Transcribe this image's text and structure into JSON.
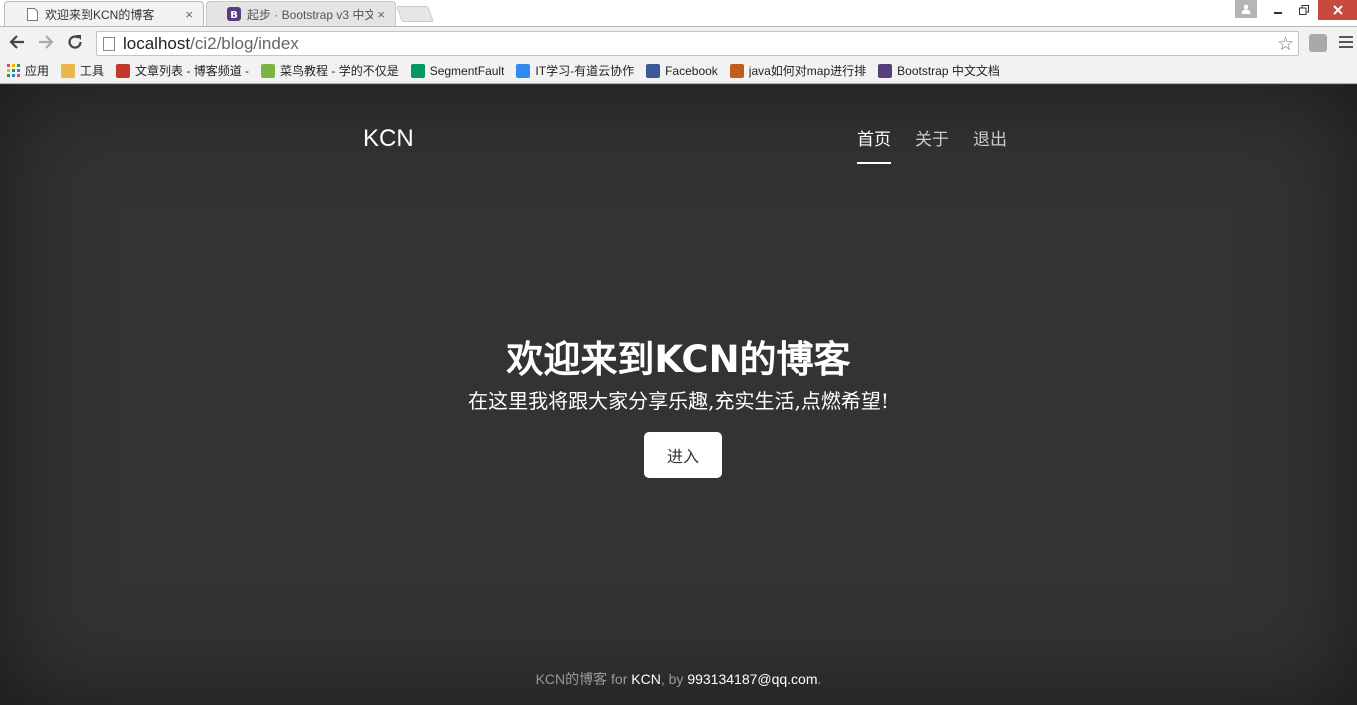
{
  "browser": {
    "tabs": [
      {
        "title": "欢迎来到KCN的博客",
        "active": true
      },
      {
        "title": "起步 · Bootstrap v3 中文",
        "active": false
      }
    ],
    "tab_close_glyph": "×",
    "url_host": "localhost",
    "url_path": "/ci2/blog/index",
    "bookmarks": [
      {
        "label": "应用",
        "icon": "apps-grid-icon",
        "color": "#e04b3a"
      },
      {
        "label": "工具",
        "icon": "folder-icon",
        "color": "#e8b84a"
      },
      {
        "label": "文章列表 - 博客频道 -",
        "icon": "csdn-icon",
        "color": "#c0392b"
      },
      {
        "label": "菜鸟教程 - 学的不仅是",
        "icon": "runoob-icon",
        "color": "#7cb342"
      },
      {
        "label": "SegmentFault",
        "icon": "segmentfault-icon",
        "color": "#009a61"
      },
      {
        "label": "IT学习-有道云协作",
        "icon": "youdao-icon",
        "color": "#2f8bf0"
      },
      {
        "label": "Facebook",
        "icon": "facebook-icon",
        "color": "#3b5998"
      },
      {
        "label": "java如何对map进行排",
        "icon": "bing-icon",
        "color": "#c25c1c"
      },
      {
        "label": "Bootstrap 中文文档",
        "icon": "bootstrap-icon",
        "color": "#563d7c"
      }
    ]
  },
  "site": {
    "brand": "KCN",
    "nav": [
      {
        "label": "首页",
        "active": true
      },
      {
        "label": "关于",
        "active": false
      },
      {
        "label": "退出",
        "active": false
      }
    ]
  },
  "hero": {
    "title": "欢迎来到KCN的博客",
    "lead": "在这里我将跟大家分享乐趣,充实生活,点燃希望!",
    "button": "进入"
  },
  "footer": {
    "prefix": "KCN的博客 for ",
    "author": "KCN",
    "middle": ", by ",
    "email": "993134187@qq.com",
    "suffix": "."
  }
}
